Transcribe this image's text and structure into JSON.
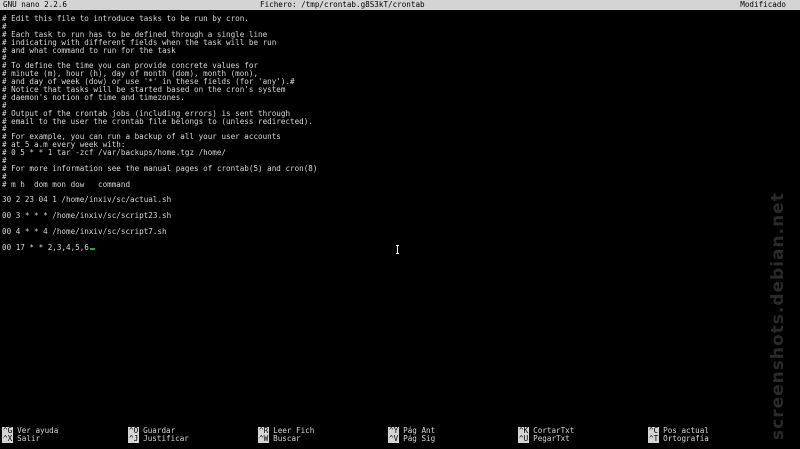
{
  "titlebar": {
    "left": "GNU nano 2.2.6",
    "center": "Fichero: /tmp/crontab.g8S3kT/crontab",
    "right": "Modificado"
  },
  "lines": [
    "# Edit this file to introduce tasks to be run by cron.",
    "#",
    "# Each task to run has to be defined through a single line",
    "# indicating with different fields when the task will be run",
    "# and what command to run for the task",
    "#",
    "# To define the time you can provide concrete values for",
    "# minute (m), hour (h), day of month (dom), month (mon),",
    "# and day of week (dow) or use '*' in these fields (for 'any').#",
    "# Notice that tasks will be started based on the cron's system",
    "# daemon's notion of time and timezones.",
    "#",
    "# Output of the crontab jobs (including errors) is sent through",
    "# email to the user the crontab file belongs to (unless redirected).",
    "#",
    "# For example, you can run a backup of all your user accounts",
    "# at 5 a.m every week with:",
    "# 0 5 * * 1 tar -zcf /var/backups/home.tgz /home/",
    "#",
    "# For more information see the manual pages of crontab(5) and cron(8)",
    "#",
    "# m h  dom mon dow   command",
    "",
    "30 2 23 04 1 /home/inxiv/sc/actual.sh",
    "",
    "00 3 * * * /home/inxiv/sc/script23.sh",
    "",
    "00 4 * * 4 /home/inxiv/sc/script7.sh",
    "",
    "00 17 * * 2,3,4,5,6"
  ],
  "shortcuts": {
    "row1": [
      {
        "key": "^G",
        "label": "Ver ayuda"
      },
      {
        "key": "^O",
        "label": "Guardar"
      },
      {
        "key": "^R",
        "label": "Leer Fich"
      },
      {
        "key": "^Y",
        "label": "Pág Ant"
      },
      {
        "key": "^K",
        "label": "CortarTxt"
      },
      {
        "key": "^C",
        "label": "Pos actual"
      }
    ],
    "row2": [
      {
        "key": "^X",
        "label": "Salir"
      },
      {
        "key": "^J",
        "label": "Justificar"
      },
      {
        "key": "^W",
        "label": "Buscar"
      },
      {
        "key": "^V",
        "label": "Pág Sig"
      },
      {
        "key": "^U",
        "label": "PegarTxt"
      },
      {
        "key": "^T",
        "label": "Ortografía"
      }
    ]
  },
  "watermark": "screenshots.debian.net",
  "colors": {
    "background": "#000000",
    "text": "#d6d6d6",
    "bar": "#d4d4d4",
    "cursor": "#2aa52a"
  }
}
